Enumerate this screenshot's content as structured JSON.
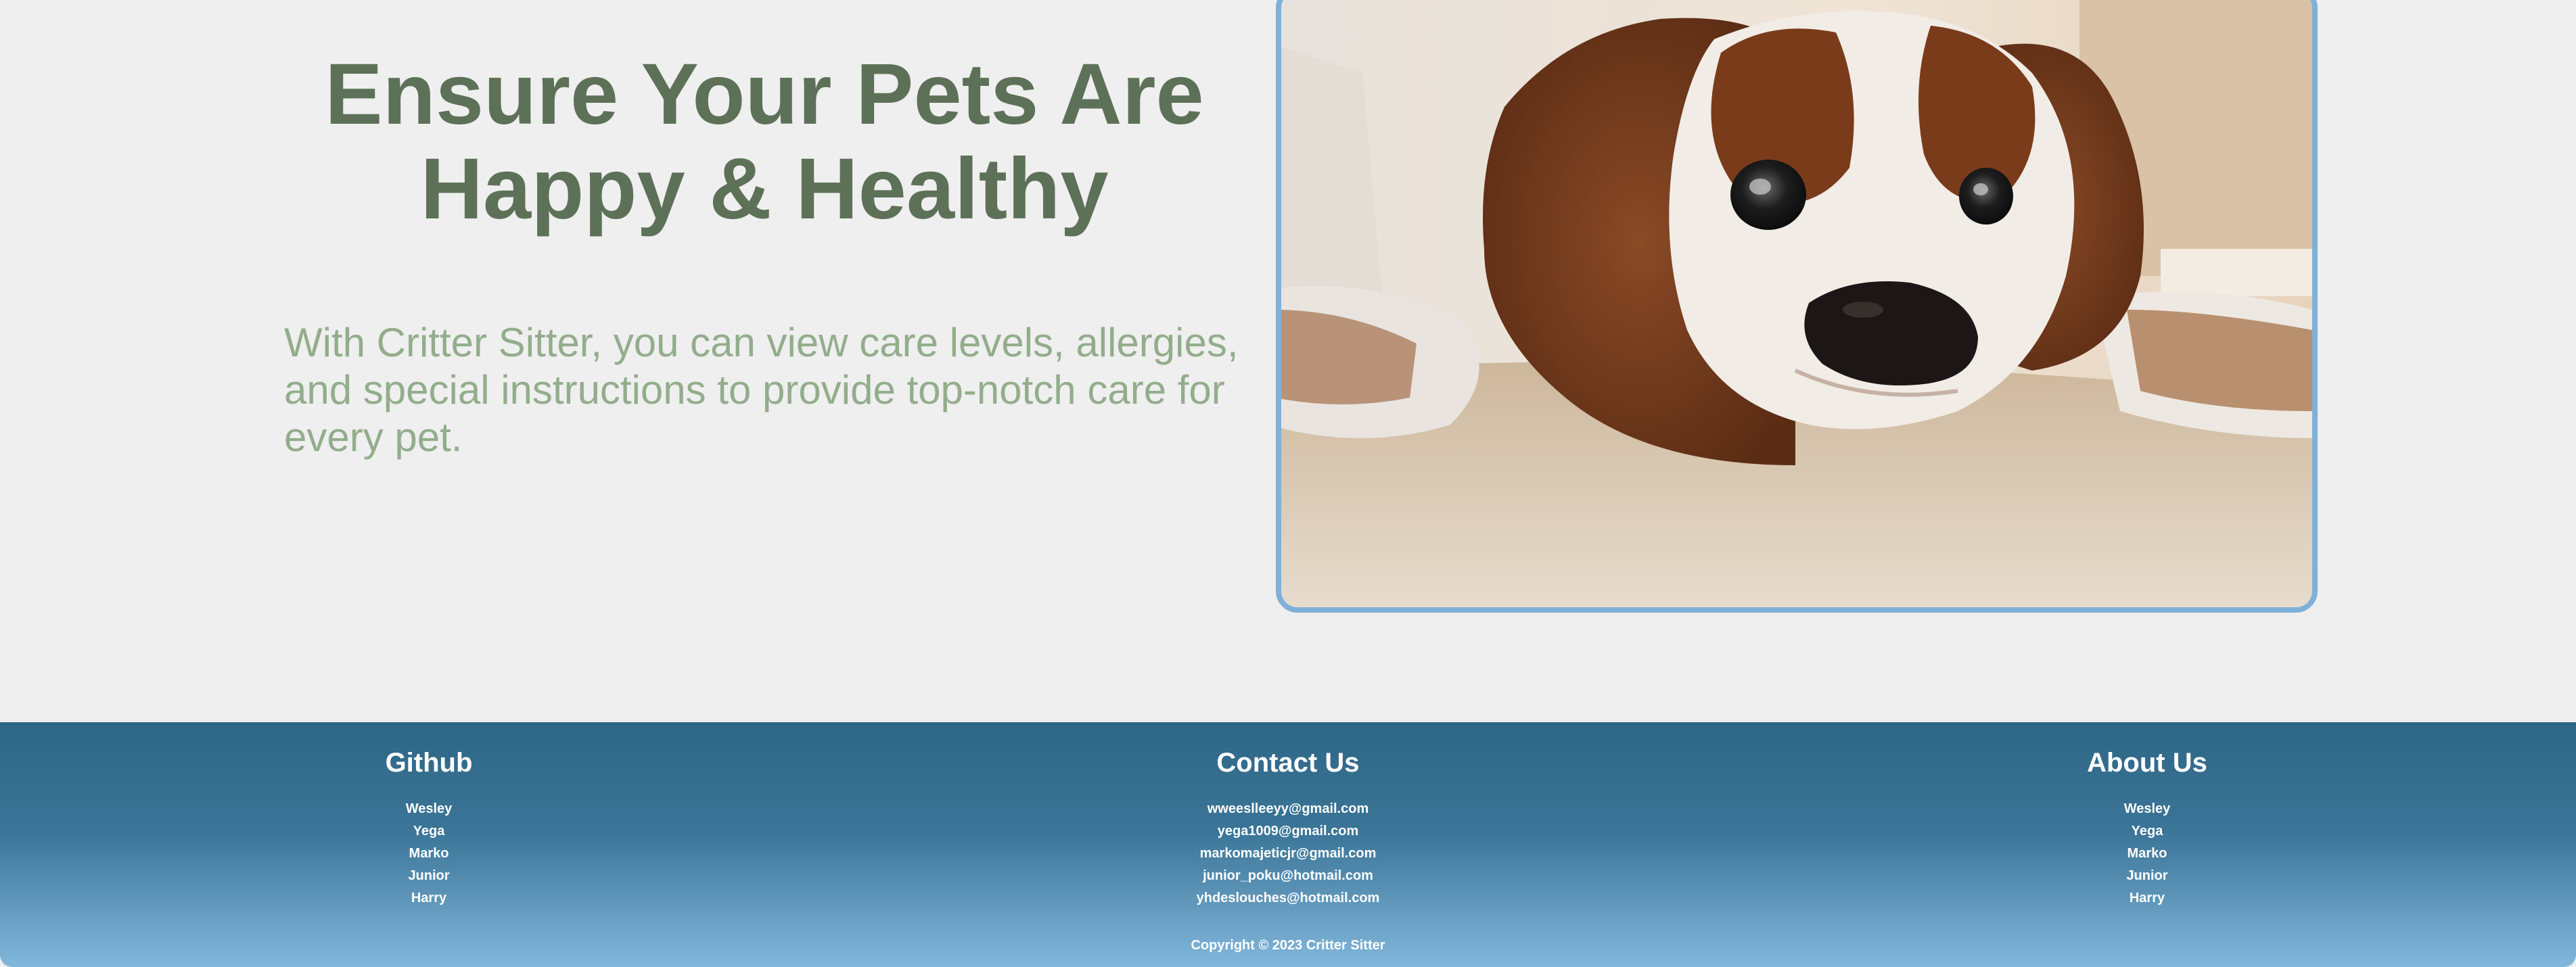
{
  "hero": {
    "title_line1": "Ensure Your Pets Are",
    "title_line2": "Happy & Healthy",
    "subtitle": "With Critter Sitter, you can view care levels, allergies, and special instructions to provide top-notch care for every pet.",
    "image_alt": "dog-photo"
  },
  "footer": {
    "github": {
      "heading": "Github",
      "items": [
        "Wesley",
        "Yega",
        "Marko",
        "Junior",
        "Harry"
      ]
    },
    "contact": {
      "heading": "Contact Us",
      "items": [
        "wweeslleeyy@gmail.com",
        "yega1009@gmail.com",
        "markomajeticjr@gmail.com",
        "junior_poku@hotmail.com",
        "yhdeslouches@hotmail.com"
      ]
    },
    "about": {
      "heading": "About Us",
      "items": [
        "Wesley",
        "Yega",
        "Marko",
        "Junior",
        "Harry"
      ]
    },
    "copyright": "Copyright © 2023 Critter Sitter"
  },
  "colors": {
    "title": "#5d7158",
    "subtitle": "#93ad8c",
    "footer_top": "#2e6686",
    "footer_bottom": "#82b7dc",
    "image_border": "#7fb0d8"
  }
}
